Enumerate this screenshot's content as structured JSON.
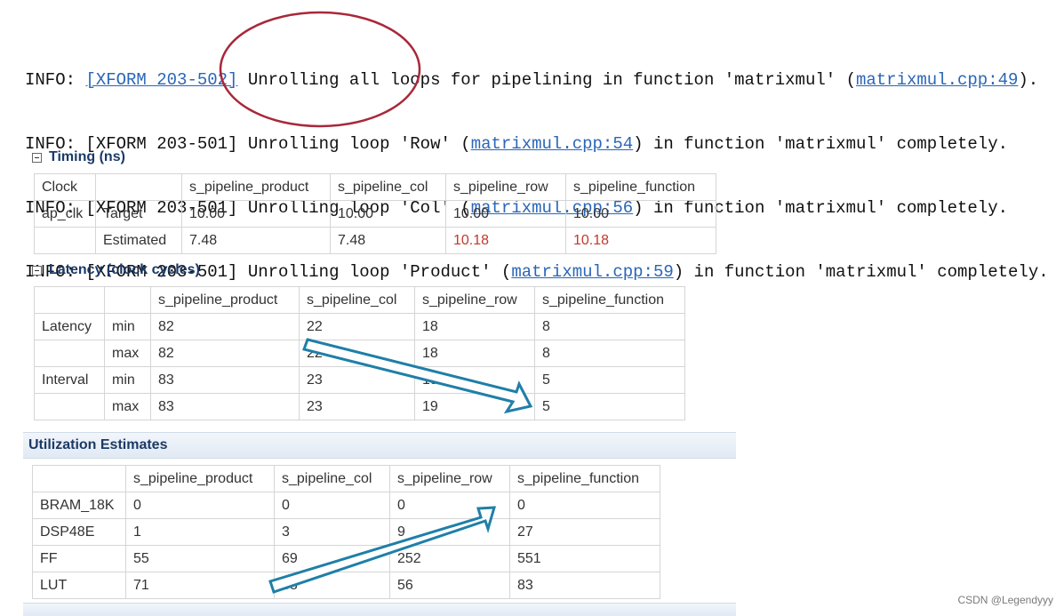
{
  "console": {
    "lines": [
      {
        "prefix": "INFO: ",
        "tag": "[XFORM 203-502]",
        "tag_link": true,
        "text_a": " Unrolling all loops for pipelining in function 'matrixmul' (",
        "link": "matrixmul.cpp:49",
        "text_b": ")."
      },
      {
        "prefix": "INFO: ",
        "tag": "[XFORM 203-501]",
        "tag_link": false,
        "text_a": " Unrolling loop 'Row' (",
        "link": "matrixmul.cpp:54",
        "text_b": ") in function 'matrixmul' completely."
      },
      {
        "prefix": "INFO: ",
        "tag": "[XFORM 203-501]",
        "tag_link": false,
        "text_a": " Unrolling loop 'Col' (",
        "link": "matrixmul.cpp:56",
        "text_b": ") in function 'matrixmul' completely."
      },
      {
        "prefix": "INFO: ",
        "tag": "[XFORM 203-501]",
        "tag_link": false,
        "text_a": " Unrolling loop 'Product' (",
        "link": "matrixmul.cpp:59",
        "text_b": ") in function 'matrixmul' completely."
      }
    ]
  },
  "timing": {
    "title": "Timing (ns)",
    "header": [
      "Clock",
      "",
      "s_pipeline_product",
      "s_pipeline_col",
      "s_pipeline_row",
      "s_pipeline_function"
    ],
    "rows": [
      [
        "ap_clk",
        "Target",
        "10.00",
        "10.00",
        "10.00",
        "10.00"
      ],
      [
        "",
        "Estimated",
        "7.48",
        "7.48",
        "10.18",
        "10.18"
      ]
    ]
  },
  "latency": {
    "title": "Latency (clock cycles)",
    "header": [
      "",
      "",
      "s_pipeline_product",
      "s_pipeline_col",
      "s_pipeline_row",
      "s_pipeline_function"
    ],
    "rows": [
      [
        "Latency",
        "min",
        "82",
        "22",
        "18",
        "8"
      ],
      [
        "",
        "max",
        "82",
        "22",
        "18",
        "8"
      ],
      [
        "Interval",
        "min",
        "83",
        "23",
        "19",
        "5"
      ],
      [
        "",
        "max",
        "83",
        "23",
        "19",
        "5"
      ]
    ]
  },
  "utilization": {
    "title": "Utilization Estimates",
    "header": [
      "",
      "s_pipeline_product",
      "s_pipeline_col",
      "s_pipeline_row",
      "s_pipeline_function"
    ],
    "rows": [
      [
        "BRAM_18K",
        "0",
        "0",
        "0",
        "0"
      ],
      [
        "DSP48E",
        "1",
        "3",
        "9",
        "27"
      ],
      [
        "FF",
        "55",
        "69",
        "252",
        "551"
      ],
      [
        "LUT",
        "71",
        "68",
        "56",
        "83"
      ]
    ]
  },
  "colors": {
    "annotation_circle": "#a8283a",
    "annotation_arrow": "#1f7fa8",
    "warning_value": "#c0392b",
    "link": "#2a66b8"
  },
  "watermark": "CSDN @Legendyyy"
}
